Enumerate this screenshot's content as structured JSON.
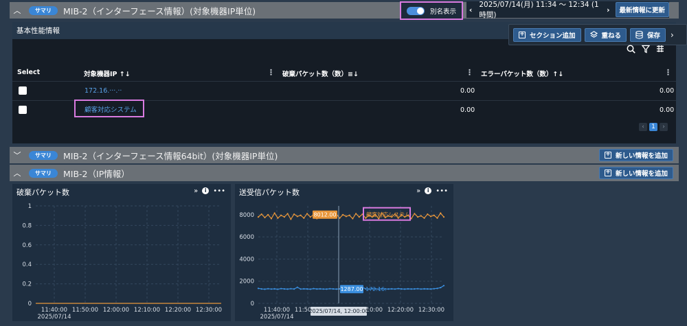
{
  "section1": {
    "badge": "サマリ",
    "title": "MIB-2（インターフェース情報）(対象機器IP単位)"
  },
  "alias_toggle": {
    "label": "別名表示",
    "on": true
  },
  "timebar": {
    "range": "2025/07/14(月) 11:34 〜 12:34 (1時間)",
    "refresh_label": "最新情報に更新"
  },
  "panel1": {
    "title": "基本性能情報"
  },
  "floatbar": {
    "add_section": "セクション追加",
    "overlay": "重ねる",
    "save": "保存"
  },
  "table": {
    "columns": [
      "Select",
      "対象機器IP ↑↓",
      "破棄パケット数（数）≡↓",
      "エラーパケット数（数）↑↓"
    ],
    "rows": [
      {
        "ip": "172.16.···.··",
        "discard": "0.00",
        "error": "0.00"
      },
      {
        "ip": "顧客対応システム",
        "discard": "0.00",
        "error": "0.00"
      }
    ],
    "pager": {
      "current": "1"
    }
  },
  "section2": {
    "badge": "サマリ",
    "title": "MIB-2（インターフェース情報64bit）(対象機器IP単位)",
    "add_label": "新しい情報を追加"
  },
  "section3": {
    "badge": "サマリ",
    "title": "MIB-2（IP情報）",
    "add_label": "新しい情報を追加"
  },
  "chart_discard": {
    "title": "破棄パケット数"
  },
  "chart_traffic": {
    "title": "送受信パケット数"
  },
  "chart_data": [
    {
      "type": "line",
      "title": "破棄パケット数",
      "x": [
        "11:34",
        "11:40",
        "11:50",
        "12:00",
        "12:10",
        "12:20",
        "12:30",
        "12:34"
      ],
      "series": [
        {
          "values": [
            0,
            0,
            0,
            0,
            0,
            0,
            0,
            0
          ],
          "color": "#e8963a"
        }
      ],
      "ylim": [
        0,
        1
      ],
      "yticks": [
        "1",
        "0.8",
        "0.6",
        "0.4",
        "0.2",
        "0"
      ],
      "xticks": [
        "11:40:00",
        "11:50:00",
        "12:00:00",
        "12:10:00",
        "12:20:00",
        "12:30:00"
      ],
      "xsub": "2025/07/14",
      "grid": true
    },
    {
      "type": "line",
      "title": "送受信パケット数",
      "x_start": "11:34",
      "x_end": "12:34",
      "series": [
        {
          "name": "顧客対応システム",
          "color": "#e8963a",
          "values": [
            7800,
            8050,
            7750,
            8000,
            7650,
            8150,
            7700,
            7950,
            7800,
            8100,
            7600,
            8050,
            7850,
            7950,
            7700,
            8100,
            7800,
            8000,
            7650,
            8200,
            7750,
            7900,
            8012,
            7800,
            8050,
            7700,
            8000,
            7850,
            7950,
            7650,
            8100,
            7800,
            8050,
            7700,
            7950,
            7800,
            8000,
            7650,
            8150,
            7750,
            7900,
            7800,
            8050,
            7700,
            8000,
            7800,
            7950,
            7650,
            8100,
            7800,
            7900,
            7700,
            8050,
            7850,
            7950,
            7700,
            8150,
            7800
          ]
        },
        {
          "name": "172.16.···.··",
          "color": "#3a8fe0",
          "values": [
            1350,
            1300,
            1280,
            1320,
            1290,
            1310,
            1275,
            1330,
            1300,
            1285,
            1320,
            1295,
            1450,
            1290,
            1310,
            1300,
            1280,
            1330,
            1295,
            1310,
            1290,
            1287,
            1320,
            1300,
            1285,
            1310,
            1295,
            1330,
            1300,
            1290,
            1320,
            1280,
            1450,
            1305,
            1290,
            1315,
            1300,
            1285,
            1320,
            1300,
            1295,
            1310,
            1290,
            1330,
            1300,
            1285,
            1310,
            1295,
            1300,
            1320,
            1290,
            1310,
            1300,
            1295,
            1320,
            1350,
            1420,
            1600
          ]
        }
      ],
      "ylim": [
        0,
        8800
      ],
      "yticks": [
        "8000",
        "6000",
        "4000",
        "2000",
        "0"
      ],
      "xticks": [
        "11:40:00",
        "11:50:00",
        "12:00:00",
        "12:10:00",
        "12:20:00",
        "12:30:00"
      ],
      "xsub": "2025/07/14",
      "tooltip": {
        "orange_value": "8012.00",
        "orange_label": "顧客対応システム",
        "blue_value": "1287.00",
        "blue_label": "172.16.···",
        "time": "2025/07/14, 12:00:00"
      },
      "grid": true
    }
  ]
}
